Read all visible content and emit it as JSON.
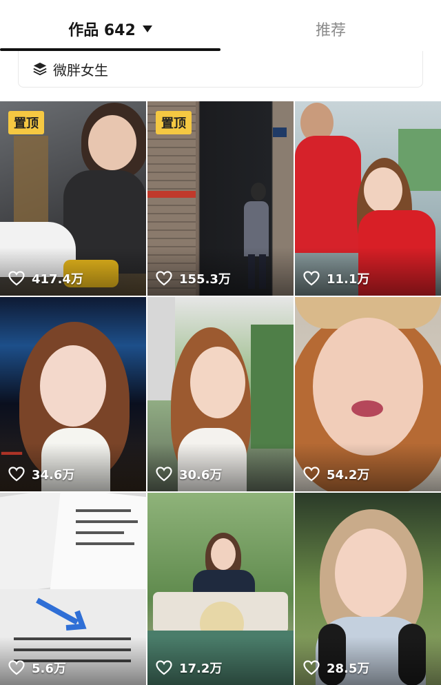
{
  "tabs": {
    "works_label": "作品 642",
    "recommend_label": "推荐"
  },
  "collection": {
    "label": "微胖女生",
    "icon": "layers-icon"
  },
  "videos": [
    {
      "likes": "417.4万",
      "pinned": "置顶"
    },
    {
      "likes": "155.3万",
      "pinned": "置顶"
    },
    {
      "likes": "11.1万"
    },
    {
      "likes": "34.6万"
    },
    {
      "likes": "30.6万"
    },
    {
      "likes": "54.2万"
    },
    {
      "likes": "5.6万"
    },
    {
      "likes": "17.2万"
    },
    {
      "likes": "28.5万"
    }
  ],
  "colors": {
    "pin_badge": "#f5c842",
    "tab_underline": "#111111",
    "inactive_tab": "#8a8a8a"
  }
}
